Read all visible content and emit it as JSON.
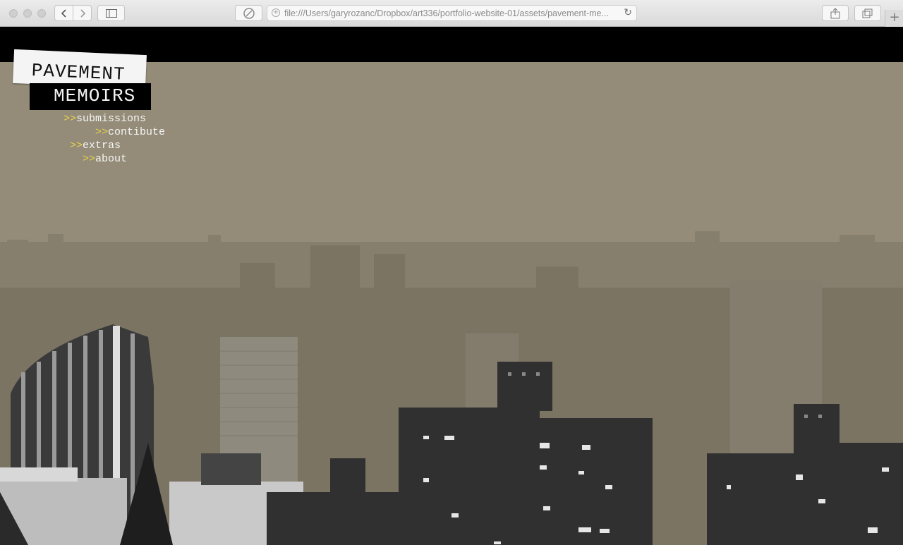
{
  "browser": {
    "url": "file:///Users/garyrozanc/Dropbox/art336/portfolio-website-01/assets/pavement-me...",
    "new_tab_label": "+"
  },
  "logo": {
    "line1": "PAVEMENT",
    "line2": "MEMOIRS"
  },
  "nav": {
    "arrow": ">>",
    "items": [
      {
        "label": "submissions"
      },
      {
        "label": "contibute"
      },
      {
        "label": "extras"
      },
      {
        "label": "about"
      }
    ]
  },
  "colors": {
    "background": "#948c78",
    "topbar": "#000000",
    "accent": "#e7d24c"
  }
}
